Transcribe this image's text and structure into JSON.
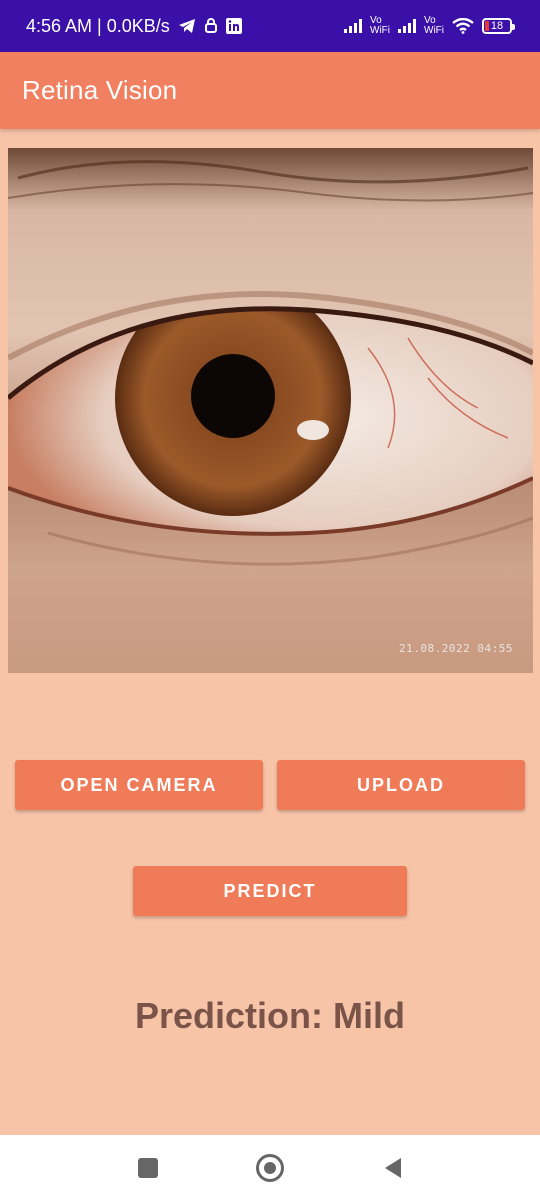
{
  "status_bar": {
    "time_speed": "4:56 AM | 0.0KB/s",
    "vo_label_1": "Vo",
    "wifi_label_1": "WiFi",
    "vo_label_2": "Vo",
    "wifi_label_2": "WiFi",
    "battery_level": "18",
    "icons": [
      "telegram-icon",
      "security-icon",
      "linkedin-icon",
      "signal-icon",
      "wifi-icon",
      "battery-icon"
    ]
  },
  "app_bar": {
    "title": "Retina Vision"
  },
  "image": {
    "timestamp": "21.08.2022 04:55"
  },
  "buttons": {
    "open_camera": "OPEN CAMERA",
    "upload": "UPLOAD",
    "predict": "PREDICT"
  },
  "prediction": {
    "text": "Prediction: Mild"
  },
  "nav_bar": {
    "icons": [
      "recents-icon",
      "home-icon",
      "back-icon"
    ]
  },
  "colors": {
    "status_bar": "#3a10a8",
    "app_bar": "#f08060",
    "background": "#f8c4a8",
    "button": "#f07b58",
    "prediction_text": "#7a5448"
  }
}
